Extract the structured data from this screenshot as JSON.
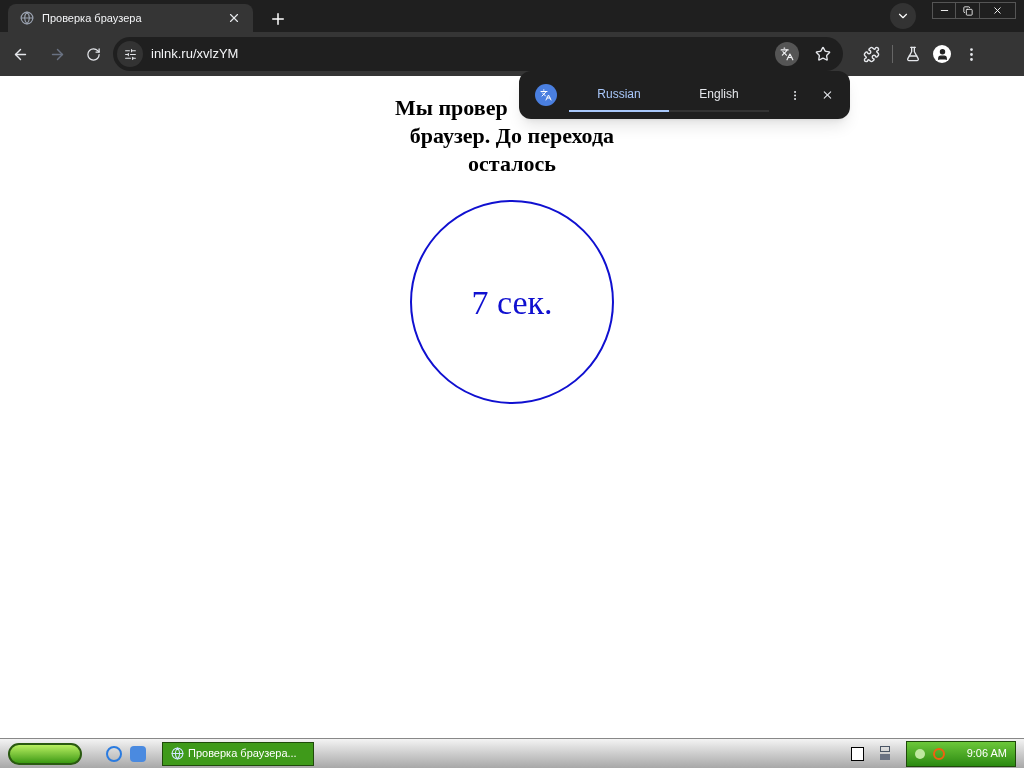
{
  "tabs": [
    {
      "title": "Проверка браузера",
      "selected": true
    }
  ],
  "address_bar": {
    "url": "inlnk.ru/xvlzYM"
  },
  "translate_popup": {
    "languages": [
      {
        "label": "Russian",
        "selected": true
      },
      {
        "label": "English",
        "selected": false
      }
    ]
  },
  "page": {
    "heading_lines": [
      "Мы провер",
      "браузер. До перехода",
      "осталось"
    ],
    "countdown": "7 сек."
  },
  "taskbar": {
    "windows": [
      {
        "title": "Проверка браузера...",
        "selected": true
      }
    ],
    "clock": "9:06 AM"
  }
}
